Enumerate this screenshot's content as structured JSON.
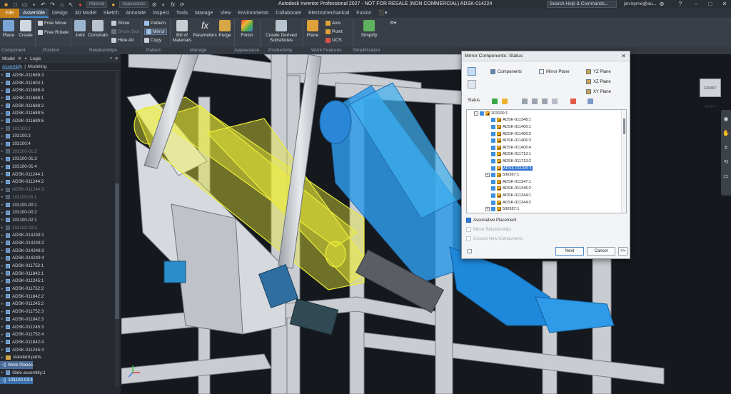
{
  "titlebar": {
    "app_title": "Autodesk Inventor Professional 2027 - NOT FOR RESALE (NON COMMERCIAL)   ADSK-014224",
    "material": "Material",
    "appearance": "Appearance",
    "search_placeholder": "Search Help & Commands...",
    "user": "jim.byrne@au...",
    "fx_label": "fx"
  },
  "tabs": [
    "File",
    "Assemble",
    "Design",
    "3D Model",
    "Sketch",
    "Annotate",
    "Inspect",
    "Tools",
    "Manage",
    "View",
    "Environments",
    "Collaborate",
    "Electromechanical",
    "Fusion"
  ],
  "ribbon": {
    "place": "Place",
    "create": "Create",
    "free_move": "Free Move",
    "free_rotate": "Free Rotate",
    "joint": "Joint",
    "constrain": "Constrain",
    "show": "Show",
    "show_sick": "Show Sick",
    "hide_all": "Hide All",
    "pattern": "Pattern",
    "mirror": "Mirror",
    "copy": "Copy",
    "bom_line1": "Bill of",
    "bom_line2": "Materials",
    "parameters": "Parameters",
    "purge": "Purge",
    "finish": "Finish",
    "cds_line1": "Create Derived",
    "cds_line2": "Substitutes",
    "plane": "Plane",
    "axis": "Axis",
    "point": "Point",
    "ucs": "UCS",
    "simplify": "Simplify",
    "fx": "fx",
    "panels": {
      "component": "Component",
      "position": "Position",
      "relationships": "Relationships",
      "pattern": "Pattern",
      "manage": "Manage",
      "appearance": "Appearance",
      "productivity": "Productivity",
      "work_features": "Work Features",
      "simplification": "Simplification"
    }
  },
  "browser": {
    "header_model": "Model",
    "header_logic": "Logic",
    "tab_assembly": "Assembly",
    "tab_modeling": "Modeling",
    "items": [
      {
        "label": "ADSK-011689:3",
        "state": "normal"
      },
      {
        "label": "ADSK-011603:1",
        "state": "normal"
      },
      {
        "label": "ADSK-011688:4",
        "state": "normal"
      },
      {
        "label": "ADSK-011688:1",
        "state": "normal"
      },
      {
        "label": "ADSK-011688:2",
        "state": "normal"
      },
      {
        "label": "ADSK-011689:5",
        "state": "normal"
      },
      {
        "label": "ADSK-011689:6",
        "state": "normal"
      },
      {
        "label": "103100:2",
        "state": "dim"
      },
      {
        "label": "103100:3",
        "state": "normal"
      },
      {
        "label": "103100:4",
        "state": "normal"
      },
      {
        "label": "103100-01:5",
        "state": "dim"
      },
      {
        "label": "103100-01:3",
        "state": "normal"
      },
      {
        "label": "103100-01:4",
        "state": "normal"
      },
      {
        "label": "ADSK-011244:1",
        "state": "normal"
      },
      {
        "label": "ADSK-011244:2",
        "state": "normal"
      },
      {
        "label": "ADSK-011244:3",
        "state": "dim"
      },
      {
        "label": "103100:03:1",
        "state": "dim"
      },
      {
        "label": "103100-00:1",
        "state": "normal"
      },
      {
        "label": "103100-00:2",
        "state": "normal"
      },
      {
        "label": "103100-02:1",
        "state": "normal"
      },
      {
        "label": "103100-02:2",
        "state": "dim"
      },
      {
        "label": "ADSK-014249:1",
        "state": "normal"
      },
      {
        "label": "ADSK-014249:2",
        "state": "normal"
      },
      {
        "label": "ADSK-014249:3",
        "state": "normal"
      },
      {
        "label": "ADSK-014249:4",
        "state": "normal"
      },
      {
        "label": "ADSK-011752:1",
        "state": "normal"
      },
      {
        "label": "ADSK-011842:1",
        "state": "normal"
      },
      {
        "label": "ADSK-011245:1",
        "state": "normal"
      },
      {
        "label": "ADSK-011752:2",
        "state": "normal"
      },
      {
        "label": "ADSK-011842:2",
        "state": "normal"
      },
      {
        "label": "ADSK-011245:2",
        "state": "normal"
      },
      {
        "label": "ADSK-011752:3",
        "state": "normal"
      },
      {
        "label": "ADSK-011842:3",
        "state": "normal"
      },
      {
        "label": "ADSK-011245:3",
        "state": "normal"
      },
      {
        "label": "ADSK-011752:4",
        "state": "normal"
      },
      {
        "label": "ADSK-011842:4",
        "state": "normal"
      },
      {
        "label": "ADSK-011245:4",
        "state": "normal"
      },
      {
        "label": "standard parts",
        "state": "folder"
      },
      {
        "label": "Work Planes",
        "state": "highlight"
      },
      {
        "label": "Slide assembly:1",
        "state": "normal"
      },
      {
        "label": "103100-03:4",
        "state": "selected"
      }
    ]
  },
  "dialog": {
    "title": "Mirror Components: Status",
    "close": "✕",
    "components_label": "Components",
    "mirror_plane_label": "Mirror Plane",
    "yz_plane": "YZ Plane",
    "xz_plane": "XZ Plane",
    "xy_plane": "XY Plane",
    "status_label": "Status",
    "tree": [
      {
        "label": "103100:1",
        "indent": 0,
        "expander": "−",
        "mark": false,
        "selected": false
      },
      {
        "label": "ADSK-011348:1",
        "indent": 1,
        "expander": "",
        "mark": true,
        "selected": false
      },
      {
        "label": "ADSK-011406:1",
        "indent": 1,
        "expander": "",
        "mark": true,
        "selected": false
      },
      {
        "label": "ADSK-011406:2",
        "indent": 1,
        "expander": "",
        "mark": true,
        "selected": false
      },
      {
        "label": "ADSK-011406:3",
        "indent": 1,
        "expander": "",
        "mark": true,
        "selected": false
      },
      {
        "label": "ADSK-011406:4",
        "indent": 1,
        "expander": "",
        "mark": true,
        "selected": false
      },
      {
        "label": "ADSK-011713:1",
        "indent": 1,
        "expander": "",
        "mark": true,
        "selected": false
      },
      {
        "label": "ADSK-011713:2",
        "indent": 1,
        "expander": "",
        "mark": true,
        "selected": false
      },
      {
        "label": "ADSK-011346:1",
        "indent": 1,
        "expander": "",
        "mark": true,
        "selected": true
      },
      {
        "label": "500367:1",
        "indent": 1,
        "expander": "+",
        "mark": true,
        "selected": false
      },
      {
        "label": "ADSK-011347:1",
        "indent": 1,
        "expander": "",
        "mark": true,
        "selected": false
      },
      {
        "label": "ADSK-011346:2",
        "indent": 1,
        "expander": "",
        "mark": true,
        "selected": false
      },
      {
        "label": "ADSK-011344:1",
        "indent": 1,
        "expander": "",
        "mark": true,
        "selected": false
      },
      {
        "label": "ADSK-011344:2",
        "indent": 1,
        "expander": "",
        "mark": true,
        "selected": false
      },
      {
        "label": "500367:1",
        "indent": 1,
        "expander": "+",
        "mark": true,
        "selected": false
      }
    ],
    "associative_placement": "Associative Placement",
    "mirror_relationships": "Mirror Relationships",
    "ground_new_components": "Ground New Components",
    "next_button": "Next",
    "cancel_button": "Cancel",
    "more_button": ">>"
  },
  "viewport": {
    "viewcube_label": "FRONT   RIGHT"
  },
  "colors": {
    "accent": "#3e8fd8",
    "file_tab": "#c6821b",
    "highlight_yellow": "#ecec3a",
    "mirror_blue": "#2f9ae8",
    "selection_blue": "#2a6fd1"
  }
}
